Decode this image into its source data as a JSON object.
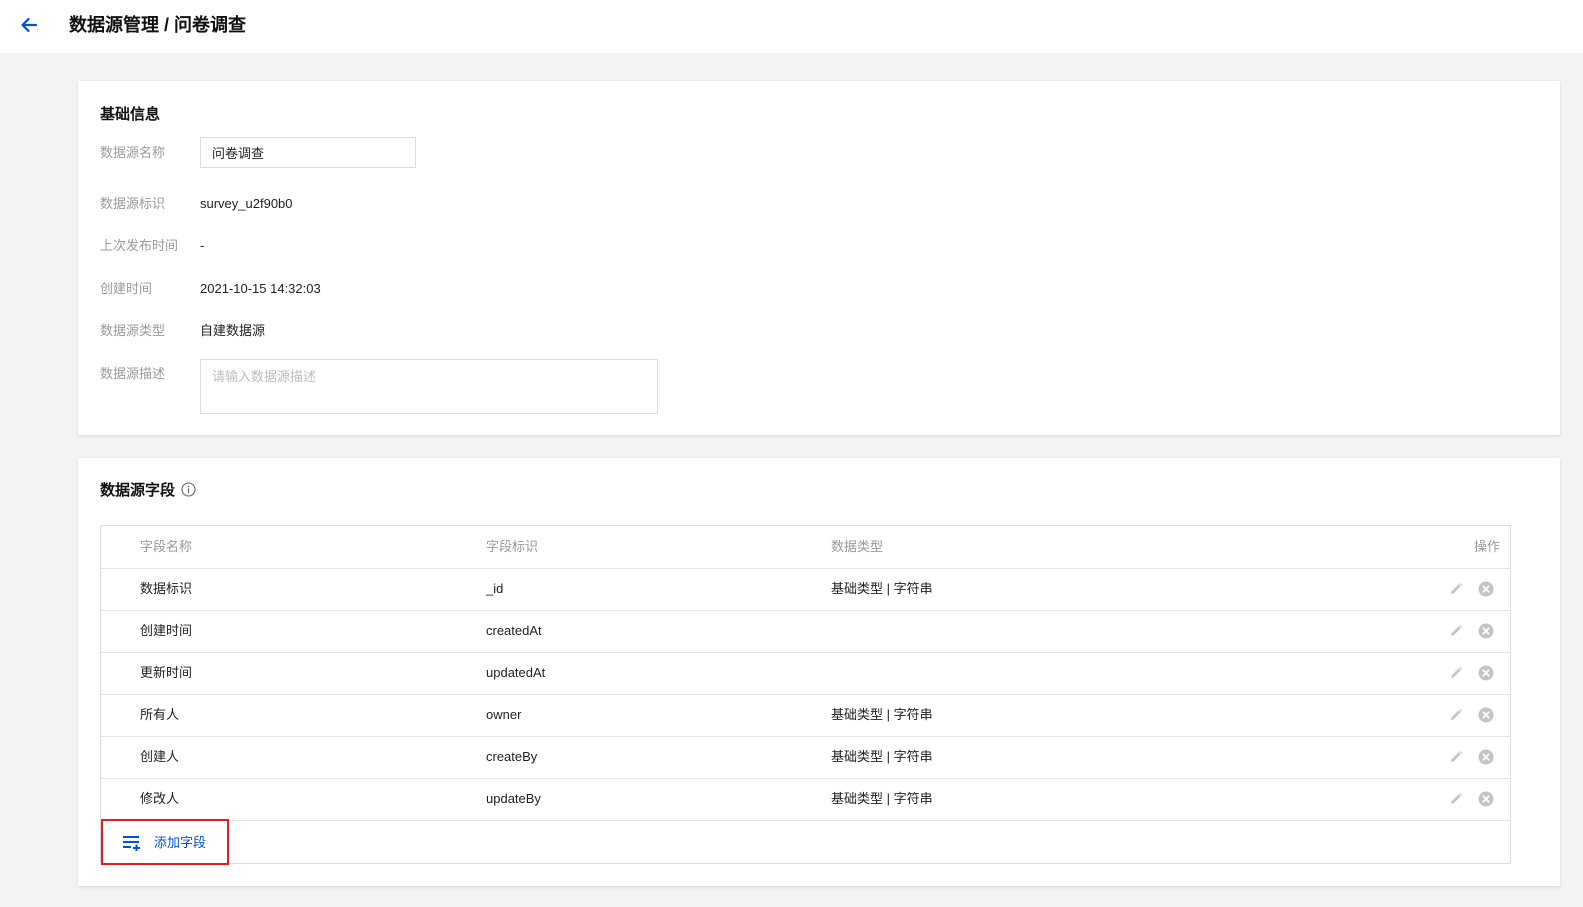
{
  "header": {
    "back_icon": "arrow-left-icon",
    "title": "数据源管理 / 问卷调查"
  },
  "basic_info": {
    "title": "基础信息",
    "name_label": "数据源名称",
    "name_value": "问卷调查",
    "id_label": "数据源标识",
    "id_value": "survey_u2f90b0",
    "last_publish_label": "上次发布时间",
    "last_publish_value": "-",
    "created_label": "创建时间",
    "created_value": "2021-10-15 14:32:03",
    "type_label": "数据源类型",
    "type_value": "自建数据源",
    "desc_label": "数据源描述",
    "desc_placeholder": "请输入数据源描述"
  },
  "fields": {
    "title": "数据源字段",
    "info_icon": "info-circle-icon",
    "columns": {
      "name": "字段名称",
      "key": "字段标识",
      "type": "数据类型",
      "action": "操作"
    },
    "rows": [
      {
        "name": "数据标识",
        "key": "_id",
        "type": "基础类型 | 字符串"
      },
      {
        "name": "创建时间",
        "key": "createdAt",
        "type": ""
      },
      {
        "name": "更新时间",
        "key": "updatedAt",
        "type": ""
      },
      {
        "name": "所有人",
        "key": "owner",
        "type": "基础类型 | 字符串"
      },
      {
        "name": "创建人",
        "key": "createBy",
        "type": "基础类型 | 字符串"
      },
      {
        "name": "修改人",
        "key": "updateBy",
        "type": "基础类型 | 字符串"
      }
    ],
    "add_label": "添加字段",
    "add_icon": "list-add-icon"
  },
  "colors": {
    "accent": "#0052d9",
    "highlight_border": "#e02020",
    "label_gray": "#9a9a9a",
    "background": "#f2f3f5"
  }
}
